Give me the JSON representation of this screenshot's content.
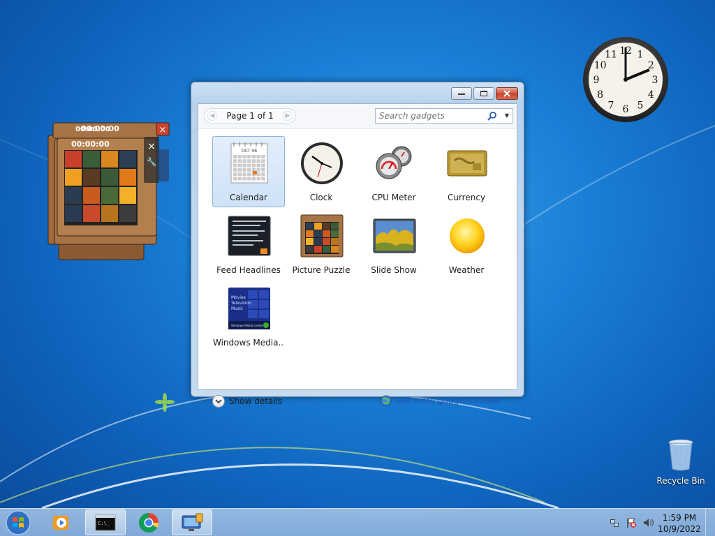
{
  "desktop": {
    "recycle_bin_label": "Recycle Bin",
    "clock_gadget_numbers": [
      "12",
      "1",
      "2",
      "3",
      "4",
      "5",
      "6",
      "7",
      "8",
      "9",
      "10",
      "11"
    ],
    "puzzle_timer_back": "00:00:00",
    "puzzle_timer_front": "00:00:00"
  },
  "gallery": {
    "pager_label": "Page 1 of 1",
    "search_placeholder": "Search gadgets",
    "gadgets": [
      {
        "name": "Calendar",
        "icon": "calendar-icon",
        "selected": true
      },
      {
        "name": "Clock",
        "icon": "clock-icon"
      },
      {
        "name": "CPU Meter",
        "icon": "cpu-meter-icon"
      },
      {
        "name": "Currency",
        "icon": "currency-icon"
      },
      {
        "name": "Feed Headlines",
        "icon": "feed-headlines-icon"
      },
      {
        "name": "Picture Puzzle",
        "icon": "picture-puzzle-icon"
      },
      {
        "name": "Slide Show",
        "icon": "slide-show-icon"
      },
      {
        "name": "Weather",
        "icon": "weather-icon"
      },
      {
        "name": "Windows Media...",
        "icon": "windows-media-icon"
      }
    ],
    "calendar_month": "OCT 06",
    "media_lines": [
      "Movies",
      "Television",
      "Music"
    ],
    "media_footer": "Windows Media Center",
    "show_details_label": "Show details",
    "get_more_label": "Get more gadgets online"
  },
  "taskbar": {
    "time": "1:59 PM",
    "date": "10/9/2022",
    "items": [
      "start-orb",
      "media-player",
      "command-prompt",
      "chrome",
      "gadgets"
    ]
  },
  "colors": {
    "link": "#1f56b7",
    "wallpaper": "#1a7fd6"
  }
}
